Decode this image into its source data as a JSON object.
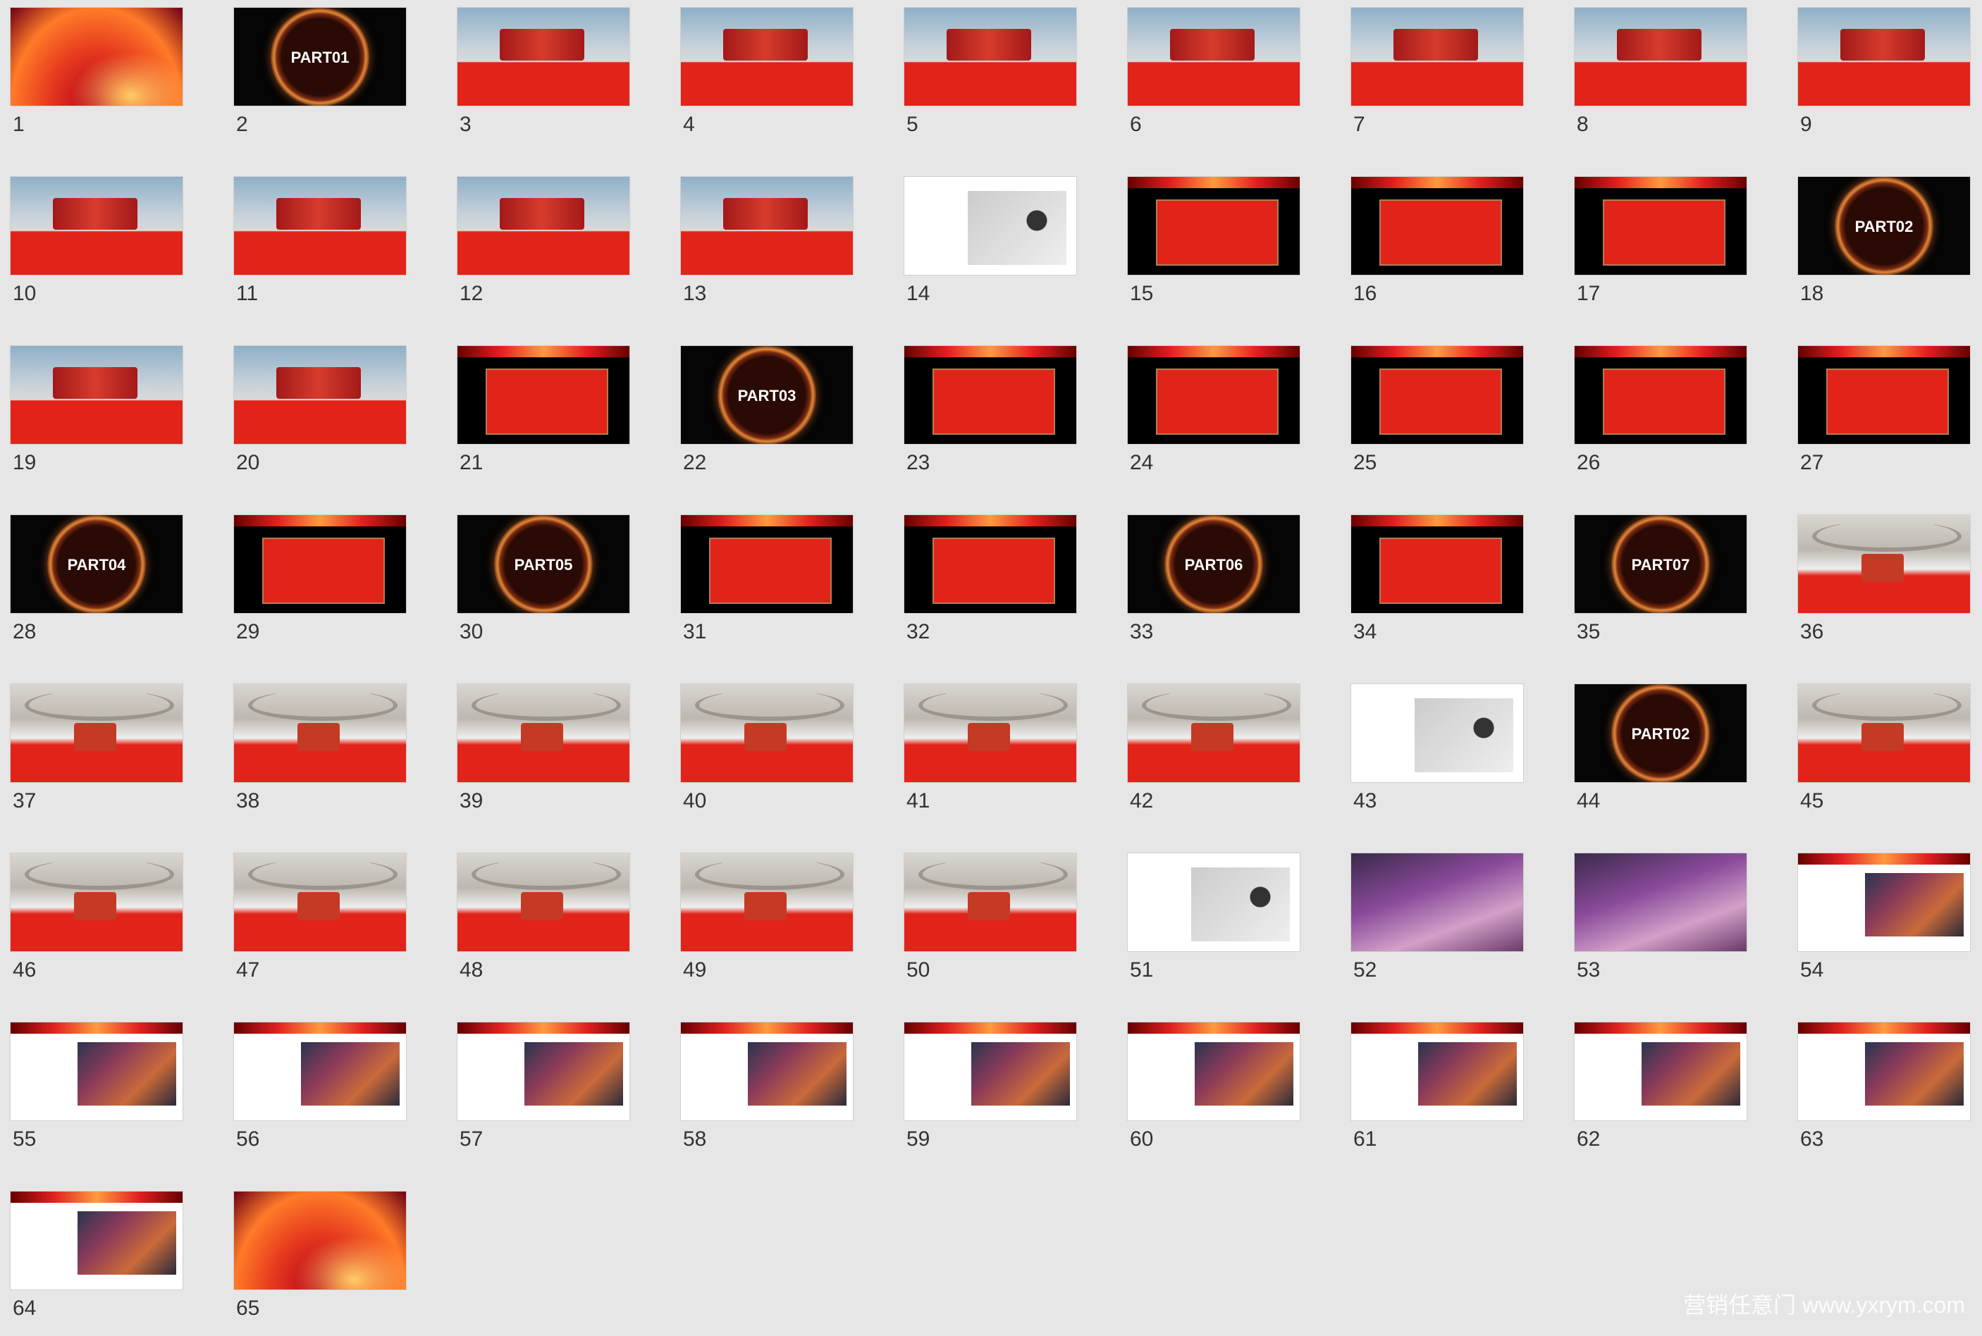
{
  "thumbnails": [
    {
      "n": "1",
      "style": "title"
    },
    {
      "n": "2",
      "style": "part",
      "label": "PART01"
    },
    {
      "n": "3",
      "style": "render"
    },
    {
      "n": "4",
      "style": "render"
    },
    {
      "n": "5",
      "style": "render"
    },
    {
      "n": "6",
      "style": "render"
    },
    {
      "n": "7",
      "style": "render"
    },
    {
      "n": "8",
      "style": "render"
    },
    {
      "n": "9",
      "style": "render"
    },
    {
      "n": "10",
      "style": "render"
    },
    {
      "n": "11",
      "style": "render"
    },
    {
      "n": "12",
      "style": "render"
    },
    {
      "n": "13",
      "style": "render"
    },
    {
      "n": "14",
      "style": "plan"
    },
    {
      "n": "15",
      "style": "dark"
    },
    {
      "n": "16",
      "style": "dark"
    },
    {
      "n": "17",
      "style": "dark"
    },
    {
      "n": "18",
      "style": "part",
      "label": "PART02"
    },
    {
      "n": "19",
      "style": "render"
    },
    {
      "n": "20",
      "style": "render"
    },
    {
      "n": "21",
      "style": "dark"
    },
    {
      "n": "22",
      "style": "part",
      "label": "PART03"
    },
    {
      "n": "23",
      "style": "dark"
    },
    {
      "n": "24",
      "style": "dark"
    },
    {
      "n": "25",
      "style": "dark"
    },
    {
      "n": "26",
      "style": "dark"
    },
    {
      "n": "27",
      "style": "dark"
    },
    {
      "n": "28",
      "style": "part",
      "label": "PART04"
    },
    {
      "n": "29",
      "style": "dark"
    },
    {
      "n": "30",
      "style": "part",
      "label": "PART05"
    },
    {
      "n": "31",
      "style": "dark"
    },
    {
      "n": "32",
      "style": "dark"
    },
    {
      "n": "33",
      "style": "part",
      "label": "PART06"
    },
    {
      "n": "34",
      "style": "dark"
    },
    {
      "n": "35",
      "style": "part",
      "label": "PART07"
    },
    {
      "n": "36",
      "style": "hall"
    },
    {
      "n": "37",
      "style": "hall"
    },
    {
      "n": "38",
      "style": "hall"
    },
    {
      "n": "39",
      "style": "hall"
    },
    {
      "n": "40",
      "style": "hall"
    },
    {
      "n": "41",
      "style": "hall"
    },
    {
      "n": "42",
      "style": "hall"
    },
    {
      "n": "43",
      "style": "plan"
    },
    {
      "n": "44",
      "style": "part",
      "label": "PART02"
    },
    {
      "n": "45",
      "style": "hall"
    },
    {
      "n": "46",
      "style": "hall"
    },
    {
      "n": "47",
      "style": "hall"
    },
    {
      "n": "48",
      "style": "hall"
    },
    {
      "n": "49",
      "style": "hall"
    },
    {
      "n": "50",
      "style": "hall"
    },
    {
      "n": "51",
      "style": "plan"
    },
    {
      "n": "52",
      "style": "photo"
    },
    {
      "n": "53",
      "style": "photo"
    },
    {
      "n": "54",
      "style": "white"
    },
    {
      "n": "55",
      "style": "white"
    },
    {
      "n": "56",
      "style": "white"
    },
    {
      "n": "57",
      "style": "white"
    },
    {
      "n": "58",
      "style": "white"
    },
    {
      "n": "59",
      "style": "white"
    },
    {
      "n": "60",
      "style": "white"
    },
    {
      "n": "61",
      "style": "white"
    },
    {
      "n": "62",
      "style": "white"
    },
    {
      "n": "63",
      "style": "white"
    },
    {
      "n": "64",
      "style": "white"
    },
    {
      "n": "65",
      "style": "title"
    }
  ],
  "watermark": "营销任意门 www.yxrym.com"
}
